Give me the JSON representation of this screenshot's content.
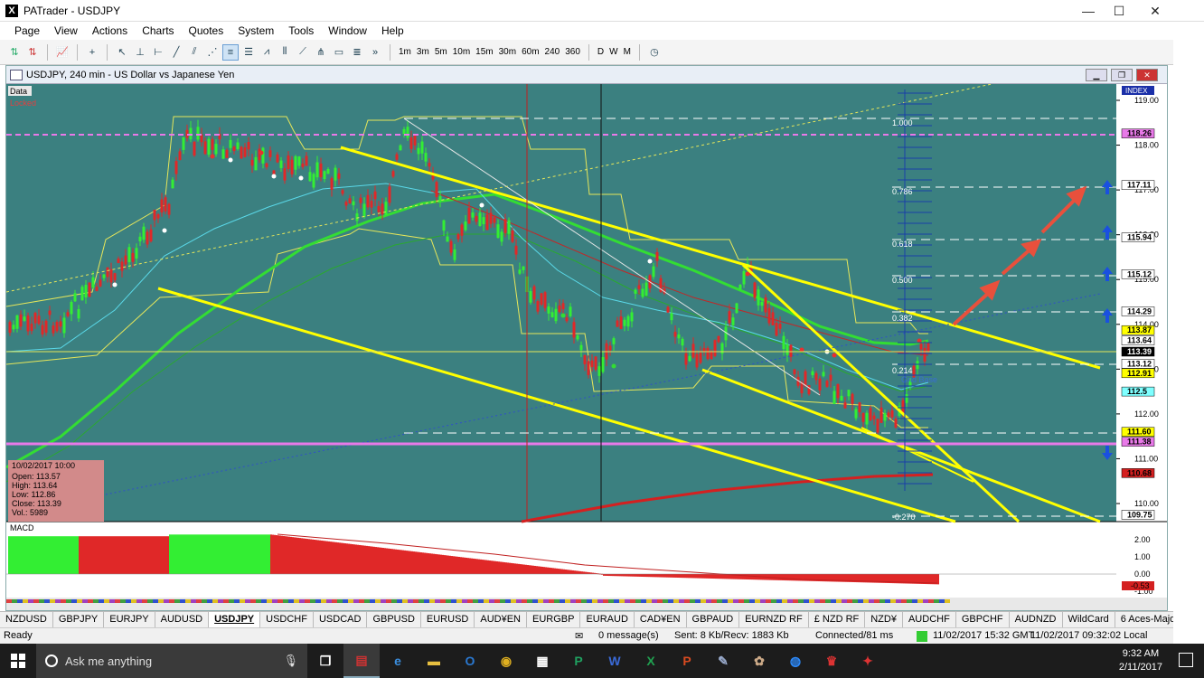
{
  "window": {
    "title": "PATrader - USDJPY",
    "icon_letter": "X"
  },
  "menu": [
    "Page",
    "View",
    "Actions",
    "Charts",
    "Quotes",
    "System",
    "Tools",
    "Window",
    "Help"
  ],
  "toolbar": {
    "timeframes": [
      "1m",
      "3m",
      "5m",
      "10m",
      "15m",
      "30m",
      "60m",
      "240",
      "360"
    ],
    "periods": [
      "D",
      "W",
      "M"
    ]
  },
  "chart": {
    "title": "USDJPY, 240 min - US Dollar vs Japanese Yen",
    "labels": {
      "data": "Data",
      "locked": "Locked",
      "index": "INDEX",
      "grid_base": "Grid Base",
      "macd": "MACD"
    },
    "info_box": {
      "date": "10/02/2017 10:00",
      "open": "Open: 113.57",
      "high": "High: 113.64",
      "low": "Low: 112.86",
      "close": "Close: 113.39",
      "vol": "Vol.: 5989"
    },
    "fib_levels": [
      "1.000",
      "0.786",
      "0.618",
      "0.500",
      "0.382",
      "0.214",
      "-0.270"
    ],
    "price_ticks": [
      "119.00",
      "118.00",
      "117.00",
      "116.00",
      "115.00",
      "114.00",
      "113.00",
      "112.00",
      "111.00",
      "110.00"
    ],
    "price_tags": [
      {
        "text": "118.26",
        "bg": "#e879e8"
      },
      {
        "text": "117.11",
        "bg": "#ffffff"
      },
      {
        "text": "115.94",
        "bg": "#ffffff"
      },
      {
        "text": "115.12",
        "bg": "#ffffff"
      },
      {
        "text": "114.29",
        "bg": "#ffffff"
      },
      {
        "text": "113.87",
        "bg": "#ffff00"
      },
      {
        "text": "113.64",
        "bg": "#ffffff"
      },
      {
        "text": "113.39",
        "bg": "#000000"
      },
      {
        "text": "113.12",
        "bg": "#ffffff"
      },
      {
        "text": "112.91",
        "bg": "#ffff00"
      },
      {
        "text": "112.5",
        "bg": "#7fffff"
      },
      {
        "text": "111.60",
        "bg": "#ffff00"
      },
      {
        "text": "111.38",
        "bg": "#e879e8"
      },
      {
        "text": "110.68",
        "bg": "#d42020"
      },
      {
        "text": "109.75",
        "bg": "#ffffff"
      }
    ],
    "macd_ticks": [
      "2.00",
      "1.00",
      "0.00",
      "-1.00"
    ],
    "macd_tag": "-0.53"
  },
  "symbol_tabs": [
    "NZDUSD",
    "GBPJPY",
    "EURJPY",
    "AUDUSD",
    "USDJPY",
    "USDCHF",
    "USDCAD",
    "GBPUSD",
    "EURUSD",
    "AUD¥EN",
    "EURGBP",
    "EURAUD",
    "CAD¥EN",
    "GBPAUD",
    "EURNZD RF",
    "£ NZD RF",
    "NZD¥",
    "AUDCHF",
    "GBPCHF",
    "AUDNZD",
    "WildCard",
    "6 Aces-Majors",
    "6 Aces-Exotics"
  ],
  "selected_tab": "USDJPY",
  "status": {
    "ready": "Ready",
    "messages": "0 message(s)",
    "sent": "Sent: 8 Kb/Recv: 1883 Kb",
    "connected": "Connected/81 ms",
    "gmt": "11/02/2017 15:32 GMT",
    "local": "11/02/2017 09:32:02 Local"
  },
  "taskbar": {
    "search_placeholder": "Ask me anything",
    "time": "9:32 AM",
    "date": "2/11/2017"
  }
}
